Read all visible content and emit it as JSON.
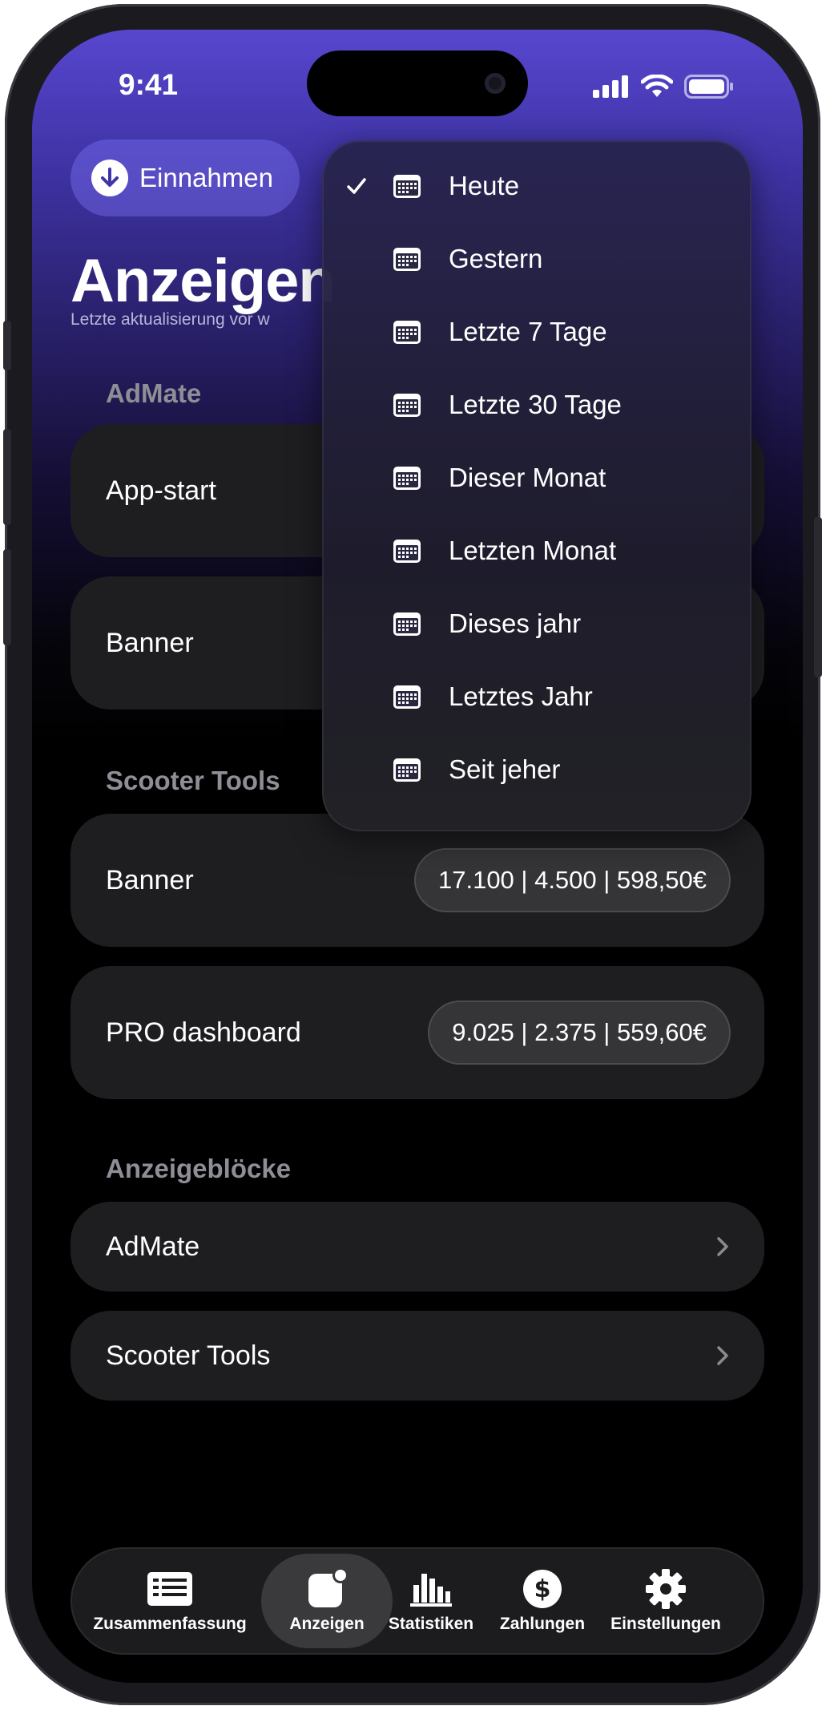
{
  "status": {
    "time": "9:41"
  },
  "header": {
    "income_button": "Einnahmen",
    "title": "Anzeigen",
    "subtitle": "Letzte aktualisierung vor w"
  },
  "sections": {
    "admate": "AdMate",
    "scooter": "Scooter Tools",
    "blocks": "Anzeigeblöcke"
  },
  "admate_cards": [
    {
      "label": "App-start"
    },
    {
      "label": "Banner"
    }
  ],
  "scooter_cards": [
    {
      "label": "Banner",
      "value": "17.100 | 4.500 | 598,50€"
    },
    {
      "label": "PRO dashboard",
      "value": "9.025 | 2.375 | 559,60€"
    }
  ],
  "block_rows": [
    {
      "label": "AdMate"
    },
    {
      "label": "Scooter Tools"
    }
  ],
  "date_menu": {
    "selected": "Heute",
    "items": [
      "Heute",
      "Gestern",
      "Letzte 7 Tage",
      "Letzte 30 Tage",
      "Dieser Monat",
      "Letzten Monat",
      "Dieses jahr",
      "Letztes Jahr",
      "Seit jeher"
    ]
  },
  "tabs": [
    {
      "label": "Zusammenfassung",
      "icon": "list-icon"
    },
    {
      "label": "Anzeigen",
      "icon": "ads-icon",
      "active": true
    },
    {
      "label": "Statistiken",
      "icon": "bar-chart-icon"
    },
    {
      "label": "Zahlungen",
      "icon": "dollar-icon"
    },
    {
      "label": "Einstellungen",
      "icon": "gear-icon"
    }
  ],
  "colors": {
    "accent": "#5747cf",
    "card": "#1e1e21",
    "pill": "#353538"
  }
}
